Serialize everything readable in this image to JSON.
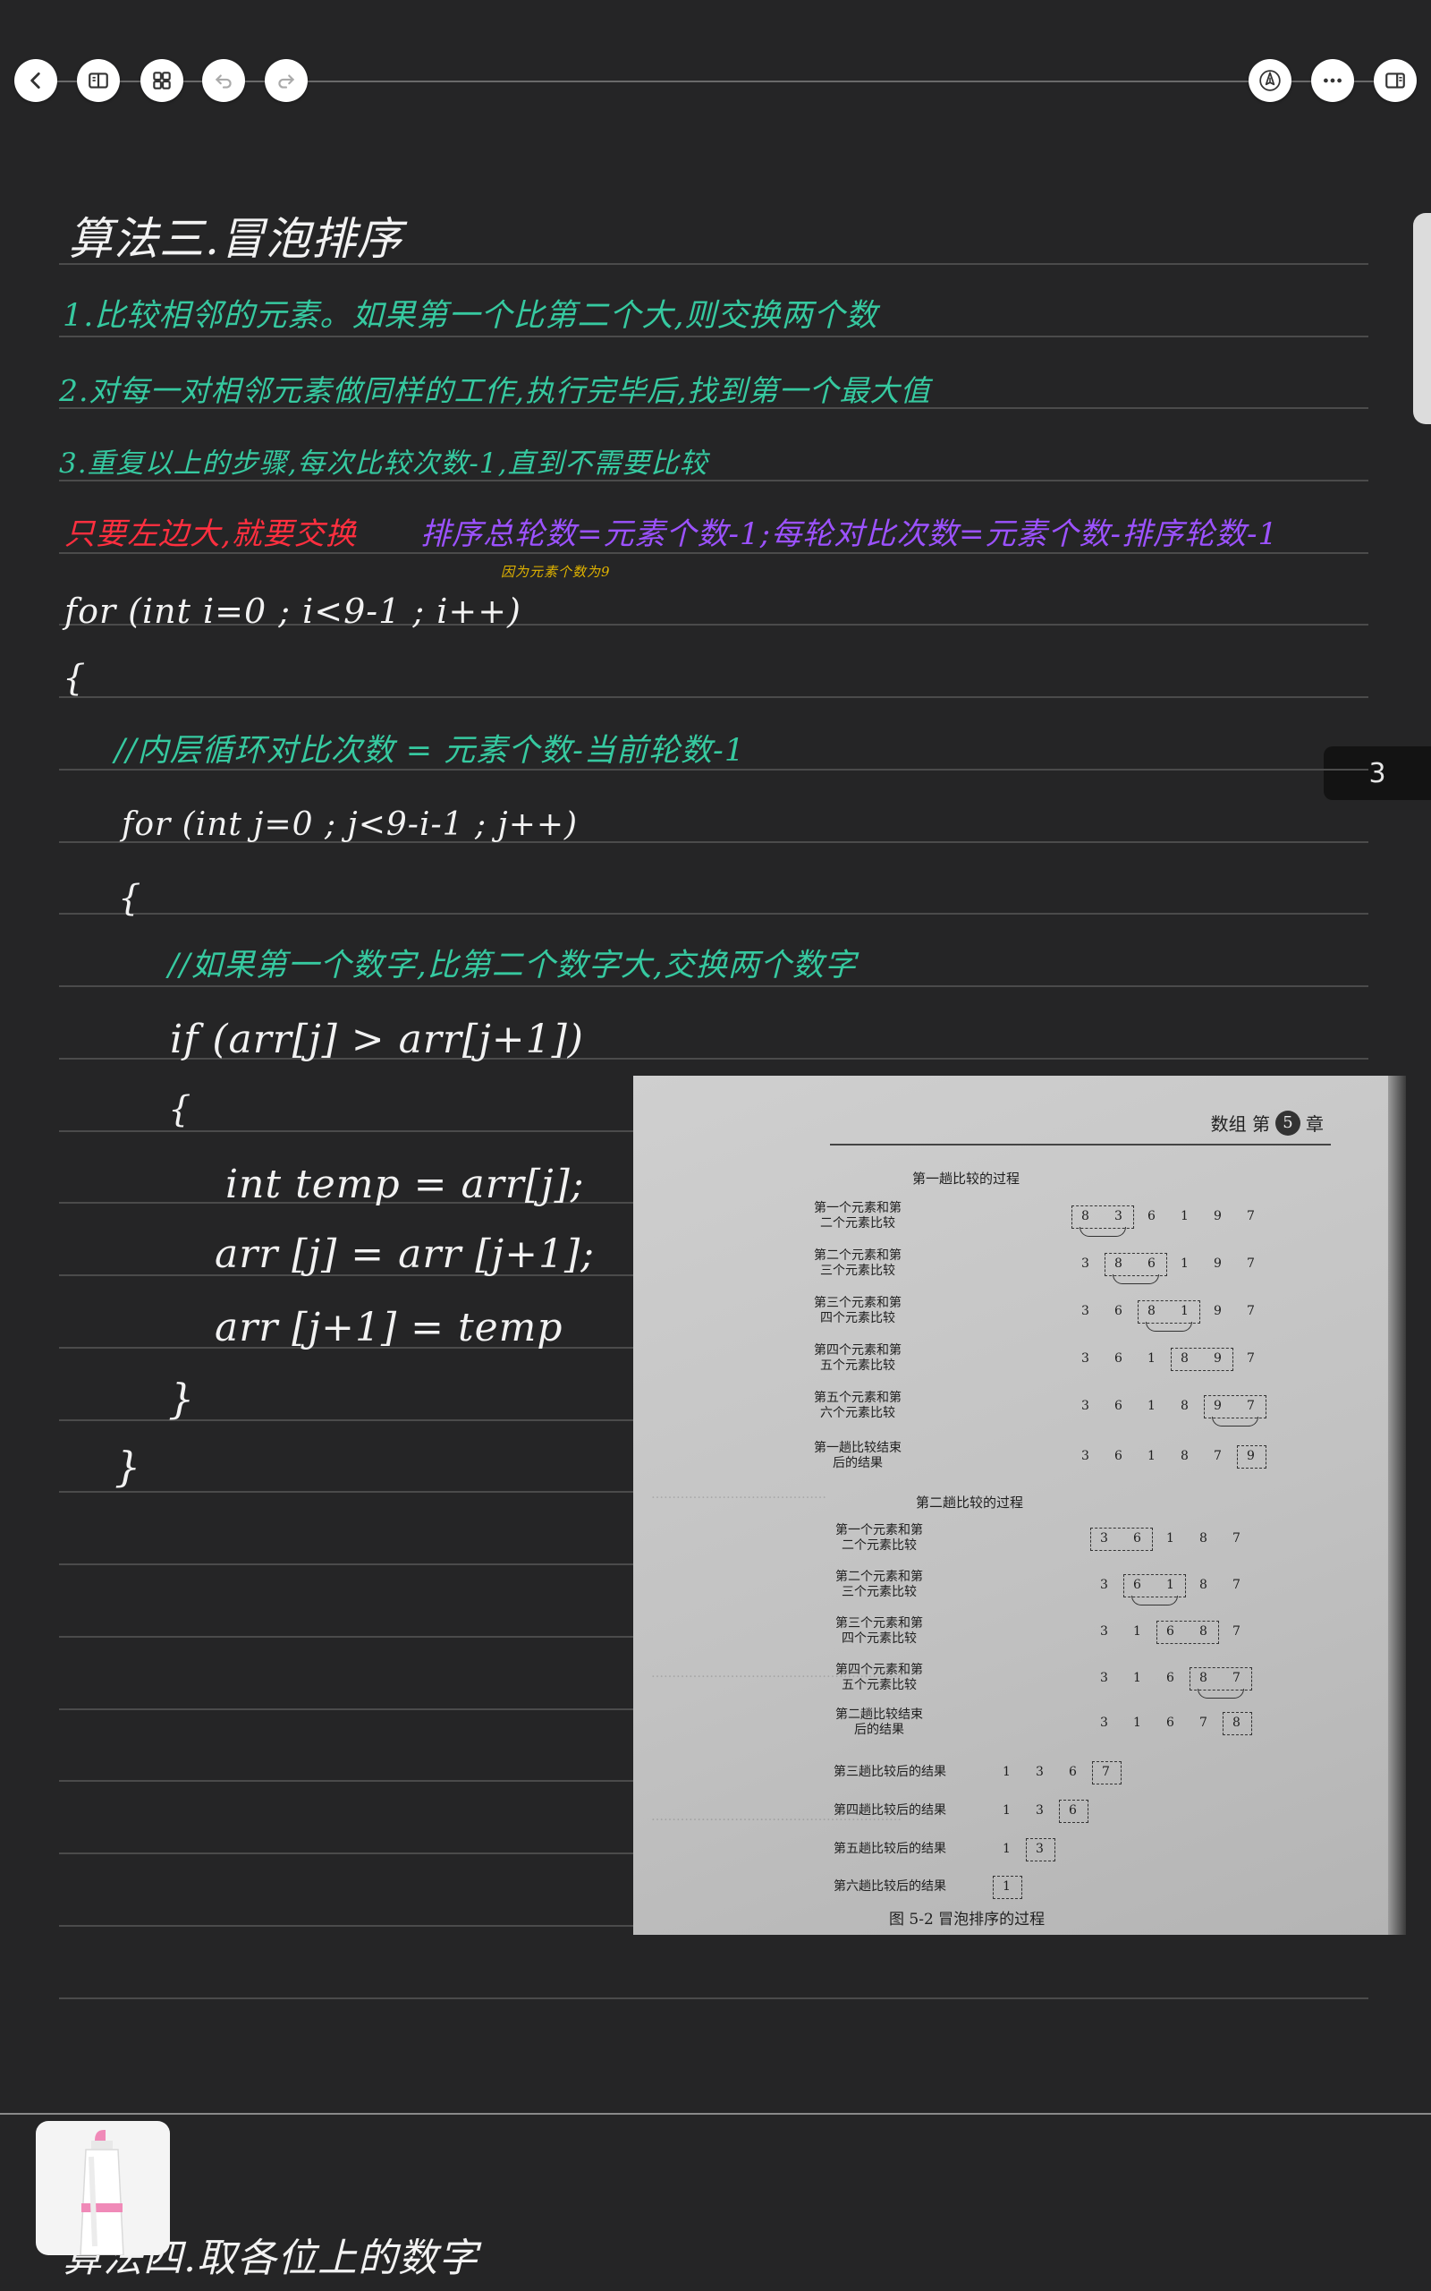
{
  "toolbar": {
    "back_icon": "chevron-left-icon",
    "book_icon": "book-open-icon",
    "grid_icon": "grid-icon",
    "undo_icon": "undo-icon",
    "redo_icon": "redo-icon",
    "pen_icon": "pen-nib-icon",
    "more_icon": "more-dots-icon",
    "sidebar_icon": "sidebar-panel-icon"
  },
  "page_indicator": "3",
  "notes": {
    "title": "算法三.冒泡排序",
    "step1": "1.比较相邻的元素。如果第一个比第二个大,则交换两个数",
    "step2": "2.对每一对相邻元素做同样的工作,执行完毕后,找到第一个最大值",
    "step3": "3.重复以上的步骤,每次比较次数-1,直到不需要比较",
    "note_red": "只要左边大,就要交换",
    "note_purple": "排序总轮数=元素个数-1;每轮对比次数=元素个数-排序轮数-1",
    "note_yellow": "因为元素个数为9",
    "code_for_outer": "for (int i=0 ; i<9-1 ; i++)",
    "code_brace_open_1": "{",
    "comment_inner": "//内层循环对比次数 = 元素个数-当前轮数-1",
    "code_for_inner": "for (int j=0 ; j<9-i-1 ; j++)",
    "code_brace_open_2": "{",
    "comment_if": "//如果第一个数字,比第二个数字大,交换两个数字",
    "code_if": "if  (arr[j] > arr[j+1])",
    "code_brace_open_3": "{",
    "code_temp": "int  temp = arr[j];",
    "code_assign": "arr  [j] = arr [j+1];",
    "code_assign2": "arr [j+1] = temp",
    "code_brace_close_3": "}",
    "code_brace_close_2": "}",
    "bottom_partial": "算法四.取各位上的数字"
  },
  "photo": {
    "header_right": "数组  第",
    "chapter_num": "5",
    "header_chapter": "章",
    "section1_title": "第一趟比较的过程",
    "section2_title": "第二趟比较的过程",
    "caption": "图 5-2   冒泡排序的过程",
    "rows1": [
      {
        "label": "第一个元素和第\n二个元素比较",
        "nums": [
          "8",
          "3",
          "6",
          "1",
          "9",
          "7"
        ]
      },
      {
        "label": "第二个元素和第\n三个元素比较",
        "nums": [
          "3",
          "8",
          "6",
          "1",
          "9",
          "7"
        ]
      },
      {
        "label": "第三个元素和第\n四个元素比较",
        "nums": [
          "3",
          "6",
          "8",
          "1",
          "9",
          "7"
        ]
      },
      {
        "label": "第四个元素和第\n五个元素比较",
        "nums": [
          "3",
          "6",
          "1",
          "8",
          "9",
          "7"
        ]
      },
      {
        "label": "第五个元素和第\n六个元素比较",
        "nums": [
          "3",
          "6",
          "1",
          "8",
          "9",
          "7"
        ]
      },
      {
        "label": "第一趟比较结束\n后的结果",
        "nums": [
          "3",
          "6",
          "1",
          "8",
          "7",
          "9"
        ]
      }
    ],
    "rows2": [
      {
        "label": "第一个元素和第\n二个元素比较",
        "nums": [
          "3",
          "6",
          "1",
          "8",
          "7"
        ]
      },
      {
        "label": "第二个元素和第\n三个元素比较",
        "nums": [
          "3",
          "6",
          "1",
          "8",
          "7"
        ]
      },
      {
        "label": "第三个元素和第\n四个元素比较",
        "nums": [
          "3",
          "1",
          "6",
          "8",
          "7"
        ]
      },
      {
        "label": "第四个元素和第\n五个元素比较",
        "nums": [
          "3",
          "1",
          "6",
          "8",
          "7"
        ]
      },
      {
        "label": "第二趟比较结束\n后的结果",
        "nums": [
          "3",
          "1",
          "6",
          "7",
          "8"
        ]
      }
    ],
    "rows3": [
      {
        "label": "第三趟比较后的结果",
        "nums": [
          "1",
          "3",
          "6",
          "7"
        ]
      },
      {
        "label": "第四趟比较后的结果",
        "nums": [
          "1",
          "3",
          "6"
        ]
      },
      {
        "label": "第五趟比较后的结果",
        "nums": [
          "1",
          "3"
        ]
      },
      {
        "label": "第六趟比较后的结果",
        "nums": [
          "1"
        ]
      }
    ]
  },
  "colors": {
    "background": "#252526",
    "ink_white": "#f2f2f2",
    "ink_green": "#36c9a0",
    "ink_red": "#ff2f3f",
    "ink_purple": "#9c52ff",
    "ink_yellow": "#e1b400"
  },
  "tool_card": {
    "icon": "highlighter-pen-icon"
  }
}
